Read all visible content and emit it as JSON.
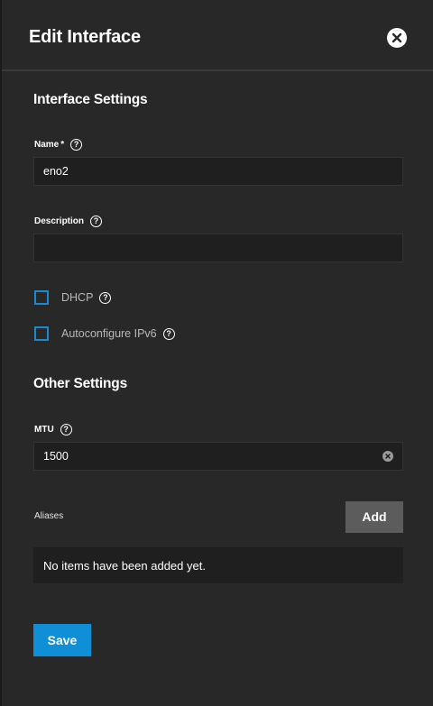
{
  "dialog": {
    "title": "Edit Interface"
  },
  "interface_settings": {
    "section_title": "Interface Settings",
    "name_label": "Name",
    "name_required": "*",
    "name_value": "eno2",
    "description_label": "Description",
    "description_value": "",
    "dhcp_label": "DHCP",
    "dhcp_checked": false,
    "autoconfigure_label": "Autoconfigure IPv6",
    "autoconfigure_checked": false
  },
  "other_settings": {
    "section_title": "Other Settings",
    "mtu_label": "MTU",
    "mtu_value": "1500"
  },
  "aliases": {
    "label": "Aliases",
    "add_label": "Add",
    "empty_text": "No items have been added yet."
  },
  "actions": {
    "save_label": "Save"
  },
  "icons": {
    "close": "close-icon",
    "help": "help-icon",
    "clear": "clear-icon"
  },
  "colors": {
    "accent": "#0f8fd6",
    "checkbox_border": "#1a8ad0",
    "panel_bg": "#282828",
    "input_bg": "#1f1f1f"
  }
}
